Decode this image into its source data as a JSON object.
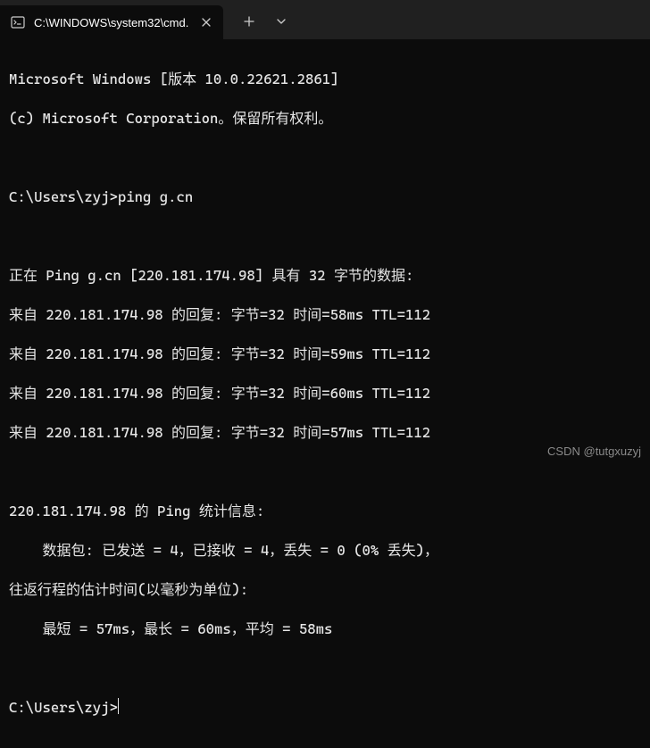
{
  "titlebar": {
    "tab": {
      "title": "C:\\WINDOWS\\system32\\cmd."
    }
  },
  "terminal": {
    "banner_line1": "Microsoft Windows [版本 10.0.22621.2861]",
    "banner_line2": "(c) Microsoft Corporation。保留所有权利。",
    "prompt1_path": "C:\\Users\\zyj>",
    "command1": "ping g.cn",
    "ping_header": "正在 Ping g.cn [220.181.174.98] 具有 32 字节的数据:",
    "reply1": "来自 220.181.174.98 的回复: 字节=32 时间=58ms TTL=112",
    "reply2": "来自 220.181.174.98 的回复: 字节=32 时间=59ms TTL=112",
    "reply3": "来自 220.181.174.98 的回复: 字节=32 时间=60ms TTL=112",
    "reply4": "来自 220.181.174.98 的回复: 字节=32 时间=57ms TTL=112",
    "stats_header": "220.181.174.98 的 Ping 统计信息:",
    "stats_packets": "    数据包: 已发送 = 4，已接收 = 4，丢失 = 0 (0% 丢失)，",
    "stats_rtt_header": "往返行程的估计时间(以毫秒为单位):",
    "stats_rtt_values": "    最短 = 57ms，最长 = 60ms，平均 = 58ms",
    "prompt2_path": "C:\\Users\\zyj>"
  },
  "watermark": "CSDN @tutgxuzyj"
}
